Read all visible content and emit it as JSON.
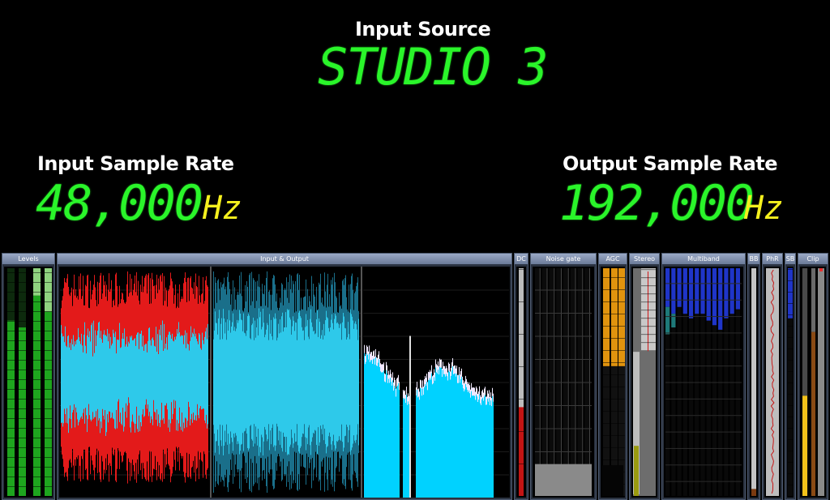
{
  "top_indicator": "",
  "input_source": {
    "label": "Input Source",
    "value": "STUDIO 3"
  },
  "input_rate": {
    "label": "Input Sample Rate",
    "value": "48,000",
    "unit": "Hz"
  },
  "output_rate": {
    "label": "Output Sample Rate",
    "value": "192,000",
    "unit": "Hz"
  },
  "panels": {
    "levels": "Levels",
    "io": "Input & Output",
    "dc": "DC",
    "noise_gate": "Noise gate",
    "agc": "AGC",
    "stereo": "Stereo",
    "multiband": "Multiband",
    "bb": "BB",
    "phr": "PhR",
    "sb": "SB",
    "clip": "Clip"
  },
  "meters": {
    "levels": [
      0.77,
      0.74,
      0.88,
      0.81
    ],
    "dc": 0.39,
    "noise_gate_floor": 0.14,
    "agc_top_orange": 0.43,
    "stereo": {
      "red_line_fraction": 0.7,
      "yellow_fill": 0.22
    },
    "multiband_top_blue": [
      0.83,
      0.8,
      0.83,
      0.8,
      0.78,
      0.8,
      0.8,
      0.77,
      0.75,
      0.73,
      0.78,
      0.8,
      0.82
    ],
    "multiband_teal_level": [
      0.71,
      0.74
    ],
    "bb": 0.02,
    "sb": 0.78,
    "clip": [
      0.44,
      0.72
    ]
  },
  "colors": {
    "segment_green": "#2af52a",
    "unit_yellow": "#f5f01e",
    "meter_green": "#1ea51e",
    "wave_red": "#e31a1a",
    "wave_cyan": "#2ec9ea",
    "spectrum_cyan": "#00d2ff",
    "agc_orange": "#e0930e",
    "multiband_blue": "#1f35c8"
  }
}
